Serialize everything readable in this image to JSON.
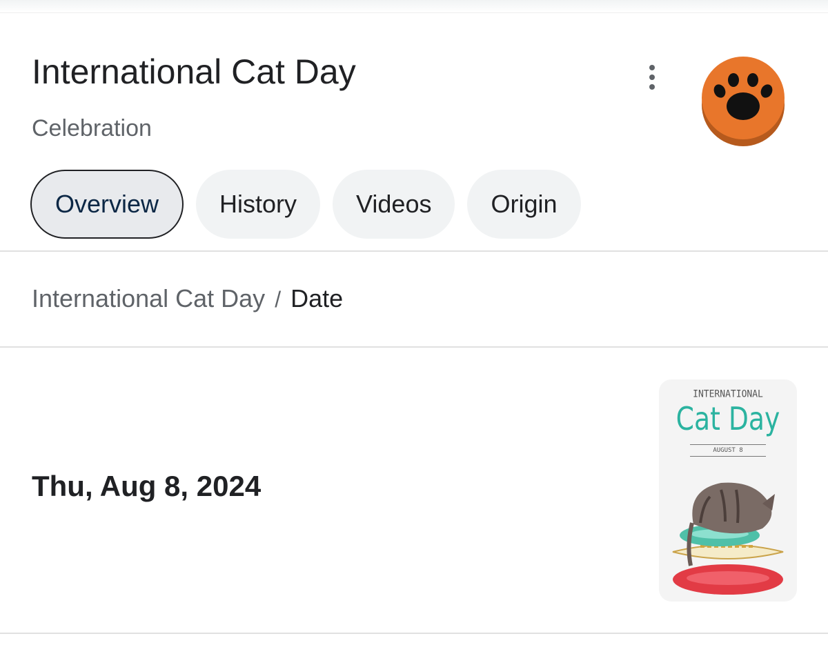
{
  "header": {
    "title": "International Cat Day",
    "subtitle": "Celebration",
    "more_icon": "more-vert-icon",
    "logo_icon": "paw-print-icon",
    "logo_colors": {
      "circle": "#E8762B",
      "shadow": "#B65A1D",
      "paw": "#111111"
    }
  },
  "tabs": [
    {
      "label": "Overview",
      "active": true
    },
    {
      "label": "History",
      "active": false
    },
    {
      "label": "Videos",
      "active": false
    },
    {
      "label": "Origin",
      "active": false
    }
  ],
  "breadcrumb": {
    "parent": "International Cat Day",
    "separator": "/",
    "current": "Date"
  },
  "result": {
    "date": "Thu, Aug 8, 2024",
    "poster": {
      "top_text": "INTERNATIONAL",
      "main_text": "Cat Day",
      "banner_text": "AUGUST 8",
      "accent_color": "#2BB3A0"
    }
  }
}
